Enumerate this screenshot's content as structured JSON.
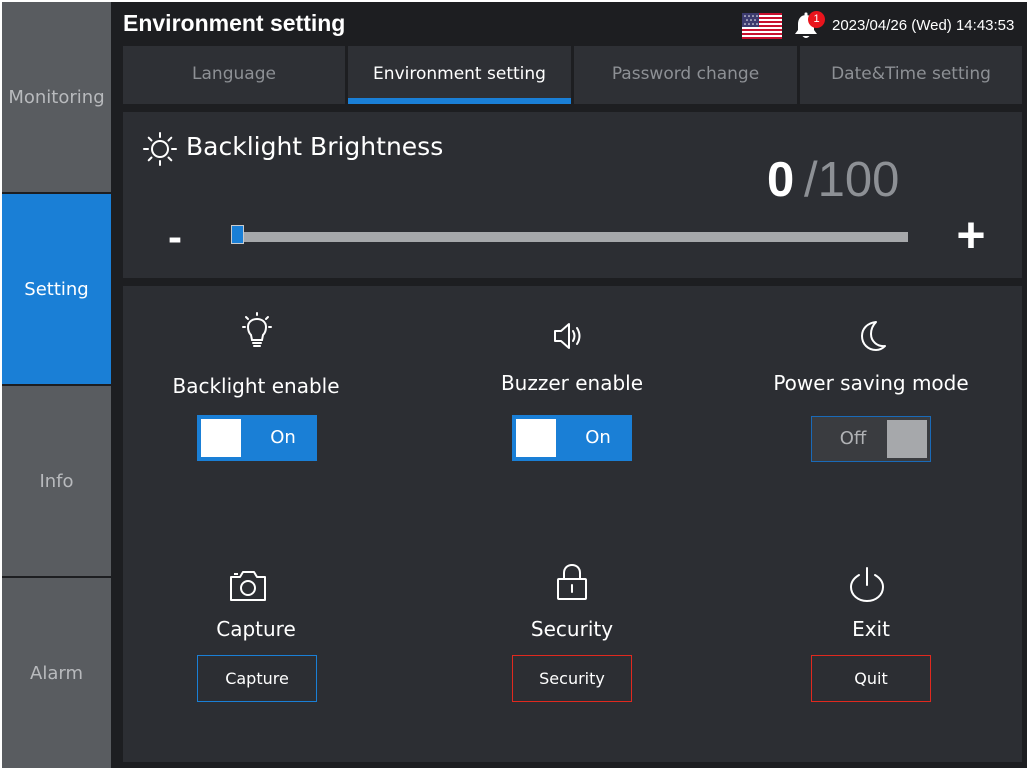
{
  "header": {
    "title": "Environment setting",
    "notification_count": "1",
    "datetime": "2023/04/26 (Wed) 14:43:53",
    "flag_icon": "us-flag-icon",
    "bell_icon": "bell-icon"
  },
  "nav": {
    "items": [
      {
        "label": "Monitoring"
      },
      {
        "label": "Setting"
      },
      {
        "label": "Info"
      },
      {
        "label": "Alarm"
      }
    ],
    "active": "Setting"
  },
  "tabs": [
    {
      "label": "Language"
    },
    {
      "label": "Environment setting"
    },
    {
      "label": "Password change"
    },
    {
      "label": "Date&Time setting"
    }
  ],
  "brightness": {
    "title": "Backlight Brightness",
    "value": 0,
    "value_label": "0",
    "max_label": "/100",
    "min": 0,
    "max": 100,
    "minus_label": "-",
    "plus_label": "+",
    "icon": "sun-icon"
  },
  "controls": {
    "backlight_enable": {
      "label": "Backlight enable",
      "state": "On",
      "icon": "lightbulb-icon"
    },
    "buzzer_enable": {
      "label": "Buzzer enable",
      "state": "On",
      "icon": "speaker-icon"
    },
    "power_saving": {
      "label": "Power saving mode",
      "state": "Off",
      "icon": "moon-icon"
    },
    "capture": {
      "label": "Capture",
      "button": "Capture",
      "icon": "camera-icon"
    },
    "security": {
      "label": "Security",
      "button": "Security",
      "icon": "lock-icon"
    },
    "exit": {
      "label": "Exit",
      "button": "Quit",
      "icon": "power-icon"
    }
  },
  "colors": {
    "accent": "#1a7fd6",
    "background": "#1d1e21",
    "panel": "#2c2e33",
    "danger": "#e0291f"
  }
}
